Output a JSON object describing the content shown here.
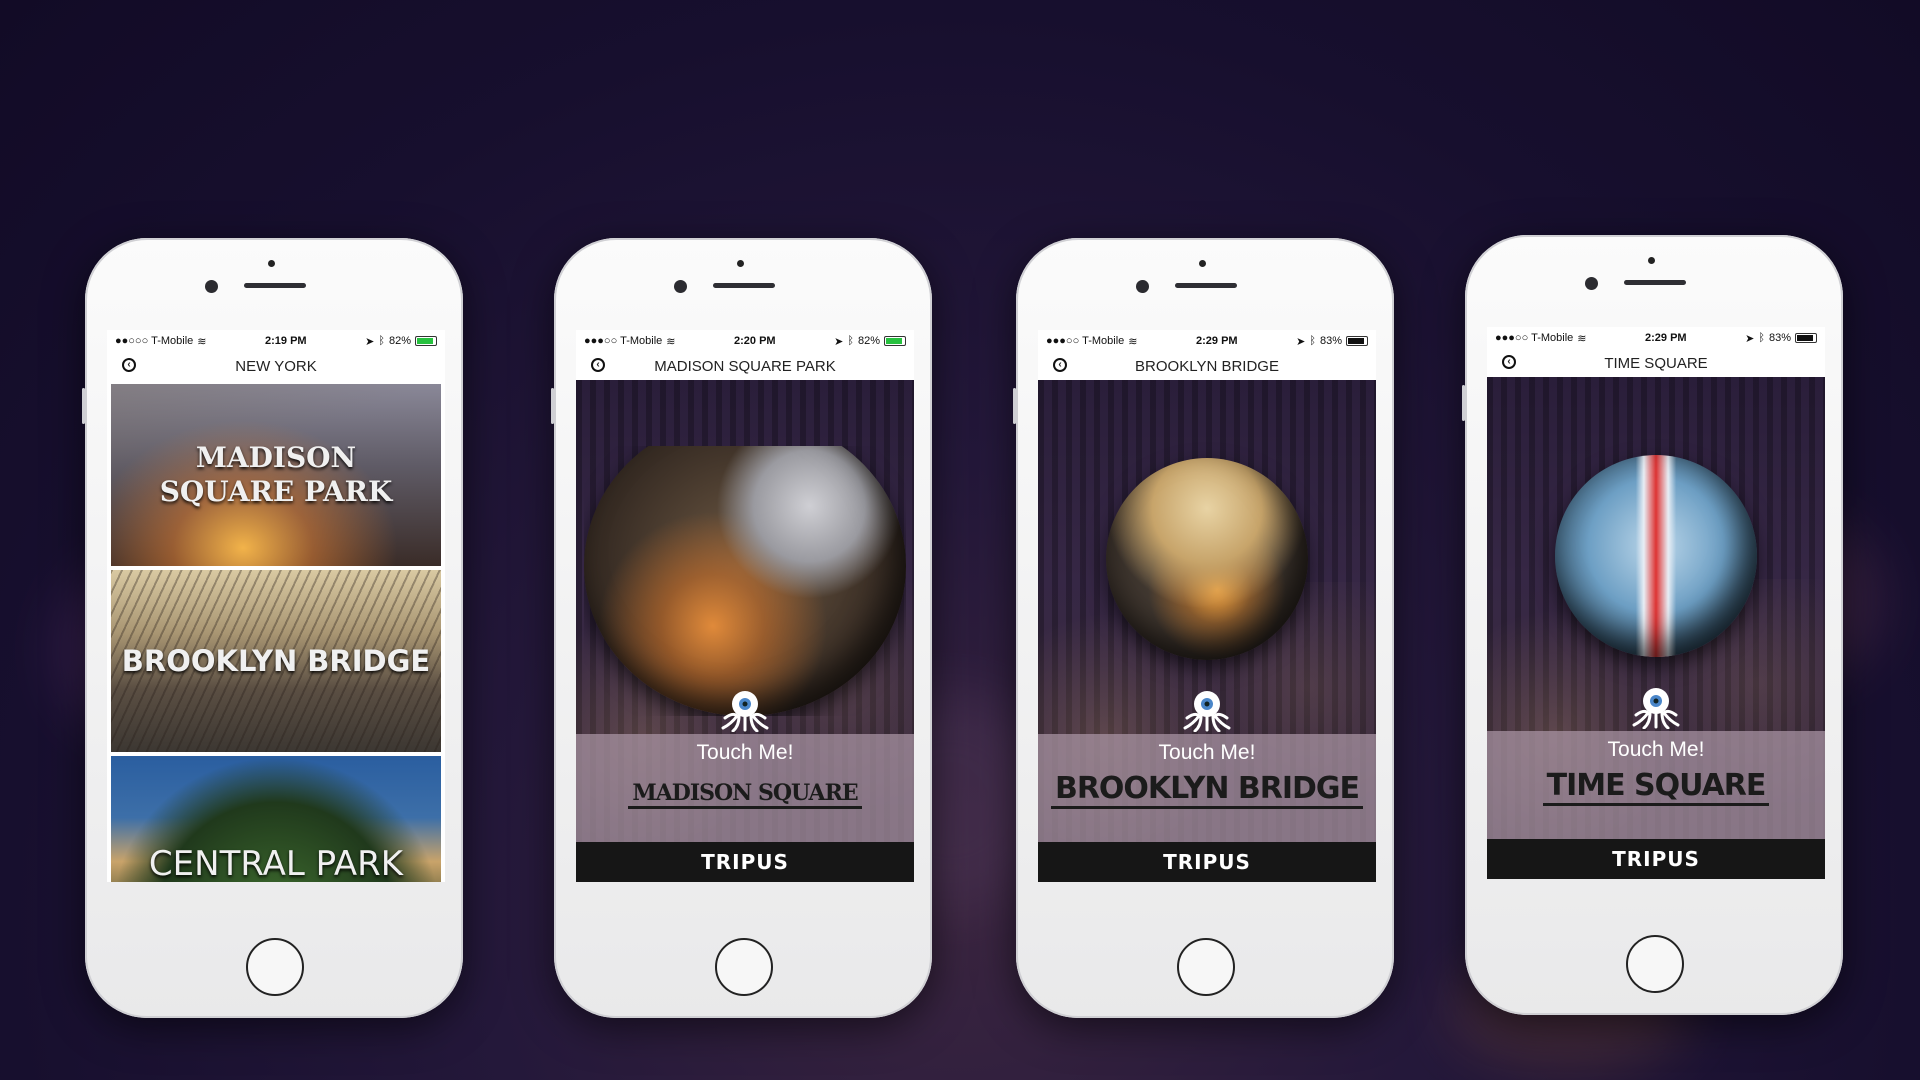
{
  "phones": [
    {
      "status": {
        "carrier": "●●○○○ T-Mobile",
        "time": "2:19 PM",
        "battery": "82%"
      },
      "title": "NEW YORK",
      "tiles": [
        {
          "label": "MADISON SQUARE PARK"
        },
        {
          "label": "BROOKLYN BRIDGE"
        },
        {
          "label": "CENTRAL PARK"
        }
      ]
    },
    {
      "status": {
        "carrier": "●●●○○ T-Mobile",
        "time": "2:20 PM",
        "battery": "82%"
      },
      "title": "MADISON SQUARE PARK",
      "touch": "Touch Me!",
      "place": "MADISON SQUARE",
      "brand": "TRIPUS"
    },
    {
      "status": {
        "carrier": "●●●○○ T-Mobile",
        "time": "2:29 PM",
        "battery": "83%"
      },
      "title": "BROOKLYN BRIDGE",
      "touch": "Touch Me!",
      "place": "BROOKLYN BRIDGE",
      "brand": "TRIPUS"
    },
    {
      "status": {
        "carrier": "●●●○○ T-Mobile",
        "time": "2:29 PM",
        "battery": "83%"
      },
      "title": "TIME SQUARE",
      "touch": "Touch Me!",
      "place": "TIME SQUARE",
      "brand": "TRIPUS"
    }
  ],
  "icons": {
    "back": "back-arrow-icon",
    "wifi": "wifi-icon",
    "location": "location-arrow-icon",
    "bluetooth": "bluetooth-icon",
    "logo": "octopus-logo-icon"
  }
}
